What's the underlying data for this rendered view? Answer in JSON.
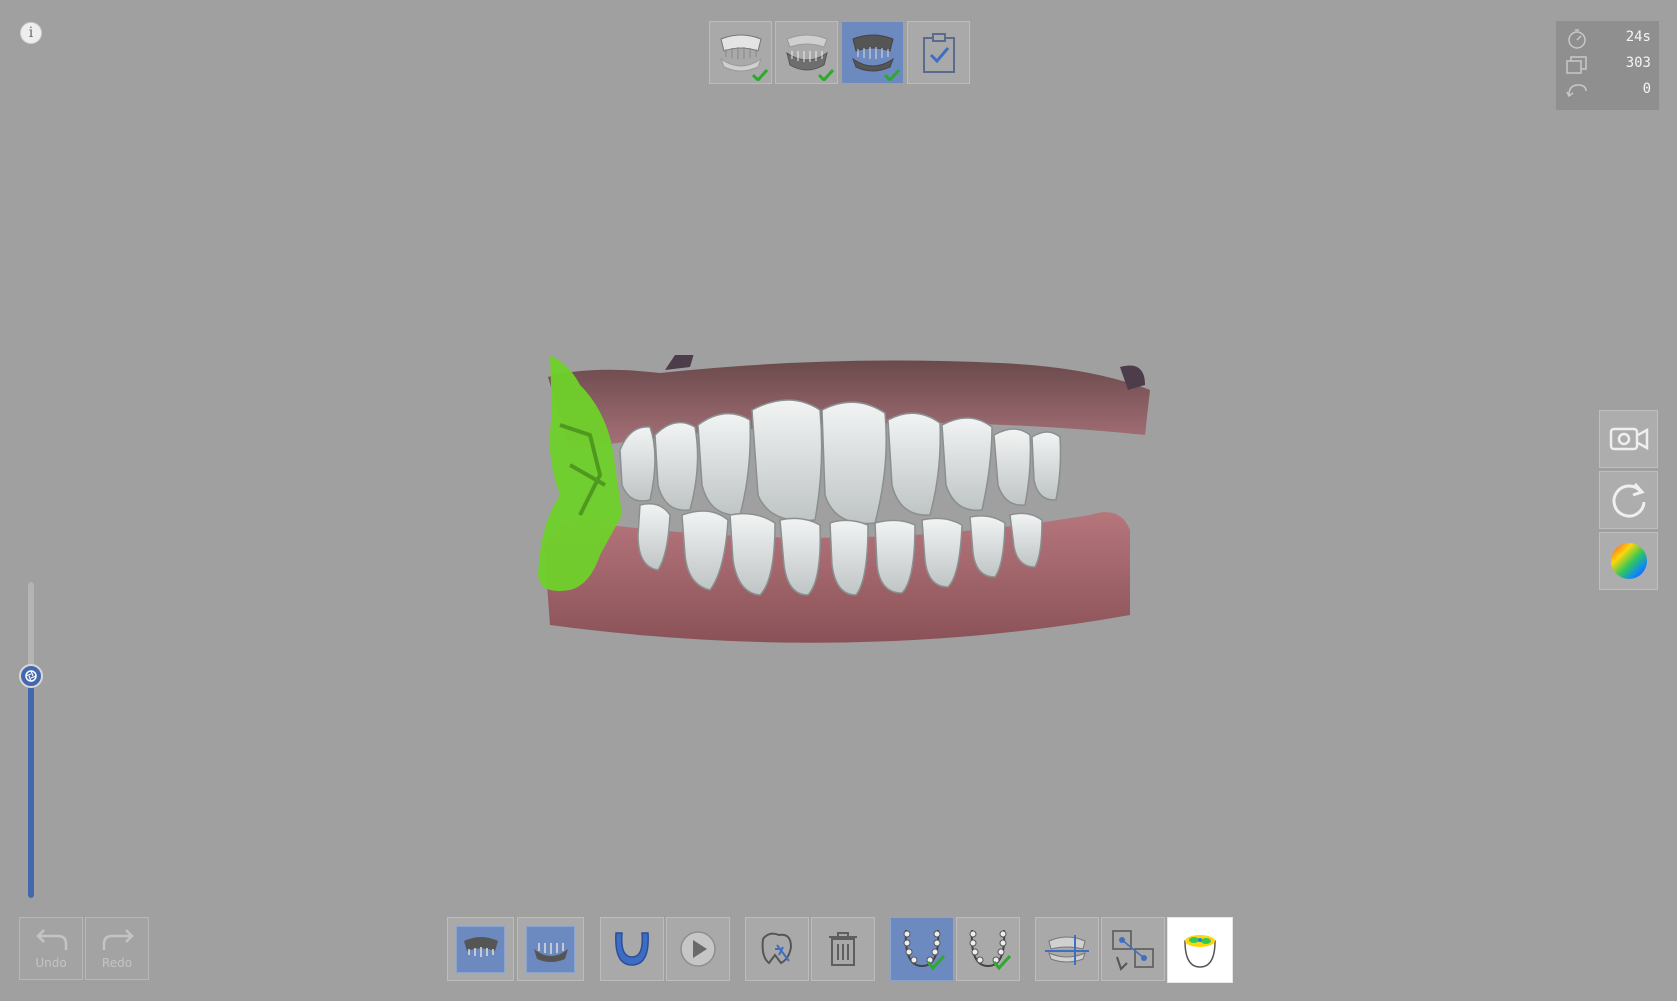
{
  "info": {
    "label": "i"
  },
  "stats": {
    "time": "24s",
    "frames": "303",
    "count": "0"
  },
  "history": {
    "undo_label": "Undo",
    "redo_label": "Redo"
  },
  "colors": {
    "background": "#a0a0a0",
    "active_button": "#6d8ac0",
    "check_green": "#2ea82e",
    "slider_blue": "#4468b0"
  },
  "scan_steps": [
    {
      "name": "upper-jaw-scan",
      "done": true
    },
    {
      "name": "lower-jaw-scan",
      "done": true
    },
    {
      "name": "bite-scan",
      "done": true,
      "active": true
    },
    {
      "name": "review-clipboard",
      "done": false
    }
  ],
  "viewport_tools": [
    "camera-icon",
    "reset-view-icon",
    "color-map-icon"
  ]
}
